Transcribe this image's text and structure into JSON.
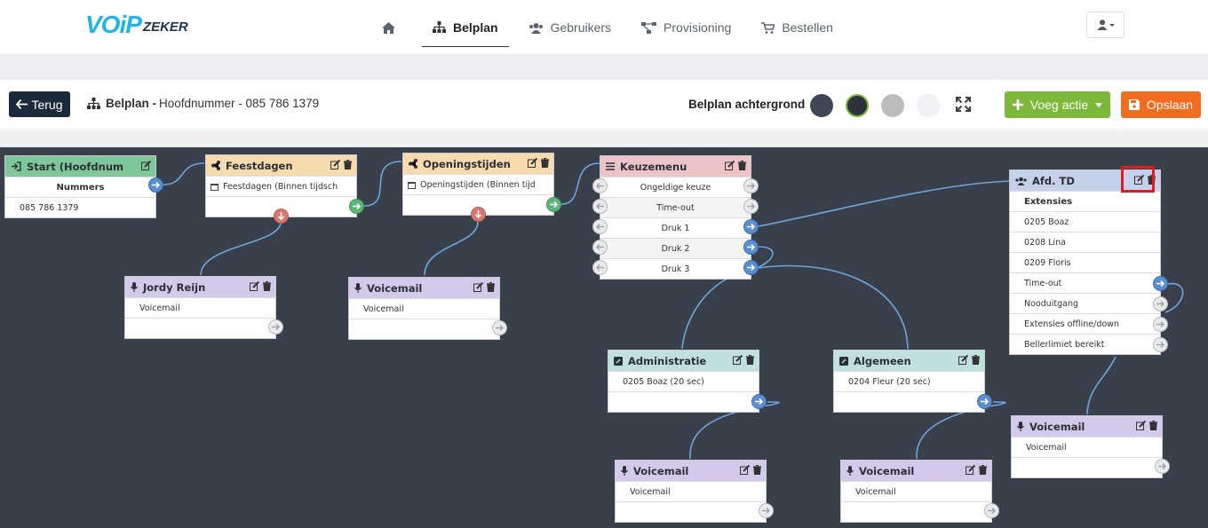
{
  "brand": {
    "logo_main": "VOiP",
    "logo_sub": "ZEKER"
  },
  "nav": {
    "home_icon": "home-icon",
    "items": [
      {
        "label": "Belplan",
        "icon": "sitemap-icon",
        "active": true
      },
      {
        "label": "Gebruikers",
        "icon": "users-icon",
        "active": false
      },
      {
        "label": "Provisioning",
        "icon": "network-icon",
        "active": false
      },
      {
        "label": "Bestellen",
        "icon": "cart-icon",
        "active": false
      }
    ]
  },
  "toolbar": {
    "back_label": "Terug",
    "breadcrumb_bold": "Belplan -",
    "breadcrumb_rest": "Hoofdnummer - 085 786 1379",
    "background_label": "Belplan achtergrond",
    "background_colors": [
      "#3e4753",
      "#2d323b",
      "#bcbcbc",
      "#f0f1f4"
    ],
    "selected_background": "#2d323b",
    "add_action_label": "Voeg actie",
    "save_label": "Opslaan"
  },
  "colors": {
    "canvas": "#393f4b",
    "wire": "#6fa6dc"
  },
  "nodes": {
    "start": {
      "title": "Start (Hoofdnum",
      "header_color": "#7ec79a",
      "rows": [
        "Nummers",
        "085 786 1379"
      ]
    },
    "feestdagen": {
      "title": "Feestdagen",
      "header_color": "#f7dbae",
      "rows": [
        "Feestdagen (Binnen tijdsch",
        ""
      ]
    },
    "openingstijden": {
      "title": "Openingstijden",
      "header_color": "#f7dbae",
      "rows": [
        "Openingstijden (Binnen tijd",
        ""
      ]
    },
    "keuzemenu": {
      "title": "Keuzemenu",
      "header_color": "#ecc4c8",
      "rows": [
        "Ongeldige keuze",
        "Time-out",
        "Druk 1",
        "Druk 2",
        "Druk 3"
      ]
    },
    "afd_td": {
      "title": "Afd. TD",
      "header_color": "#c5d1ea",
      "rows": [
        "Extensies",
        "0205 Boaz",
        "0208 Lina",
        "0209 Floris",
        "Time-out",
        "Nooduitgang",
        "Extensies offline/down",
        "Bellerlimiet bereikt"
      ]
    },
    "jordy": {
      "title": "Jordy Reijn",
      "header_color": "#d3c9ea",
      "rows": [
        "Voicemail",
        ""
      ]
    },
    "voicemail1": {
      "title": "Voicemail",
      "header_color": "#d3c9ea",
      "rows": [
        "Voicemail",
        ""
      ]
    },
    "administratie": {
      "title": "Administratie",
      "header_color": "#bfe0dc",
      "rows": [
        "0205 Boaz (20 sec)",
        ""
      ]
    },
    "algemeen": {
      "title": "Algemeen",
      "header_color": "#bfe0dc",
      "rows": [
        "0204 Fleur (20 sec)",
        ""
      ]
    },
    "voicemail2": {
      "title": "Voicemail",
      "header_color": "#d3c9ea",
      "rows": [
        "Voicemail",
        ""
      ]
    },
    "voicemail3": {
      "title": "Voicemail",
      "header_color": "#d3c9ea",
      "rows": [
        "Voicemail",
        ""
      ]
    },
    "voicemail4": {
      "title": "Voicemail",
      "header_color": "#d3c9ea",
      "rows": [
        "Voicemail",
        ""
      ]
    }
  }
}
